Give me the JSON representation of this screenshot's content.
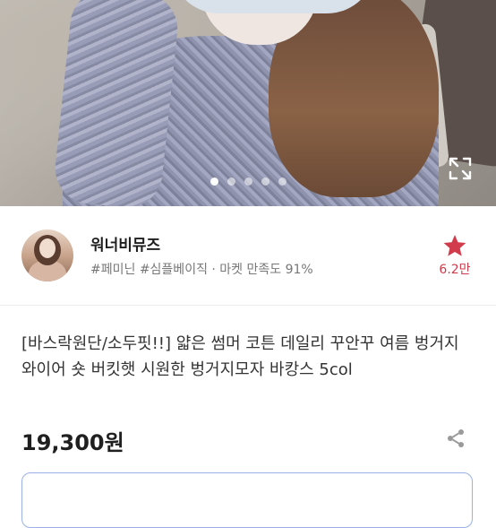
{
  "gallery": {
    "slides": 5,
    "current_slide": 1,
    "expand_icon": "expand-icon"
  },
  "seller": {
    "name": "워너비뮤즈",
    "tags": "#페미닌 #심플베이직 · 마켓 만족도 91%",
    "favorite_count": "6.2만",
    "favorite_icon": "star-icon",
    "colors": {
      "star": "#d13b4b",
      "tags": "#777777"
    }
  },
  "product": {
    "title": "[바스락원단/소두핏!!] 얇은 썸머 코튼 데일리 꾸안꾸 여름 벙거지 와이어 숏 버킷햇 시원한 벙거지모자 바캉스 5col",
    "price": "19,300원",
    "share_icon": "share-icon"
  },
  "coupon": {
    "border_color": "#9ab0e6"
  }
}
